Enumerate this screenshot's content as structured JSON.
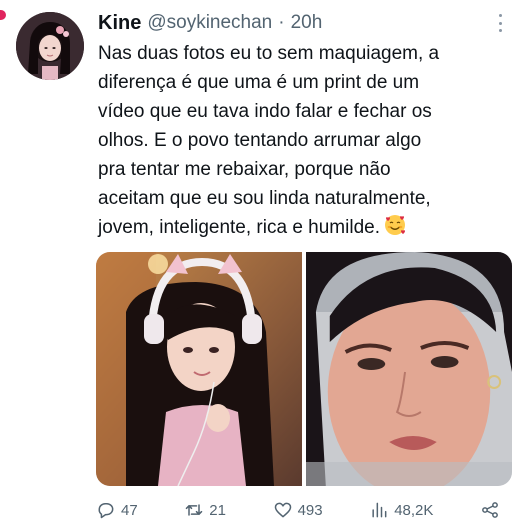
{
  "tweet": {
    "author_name": "Kine",
    "handle": "@soykinechan",
    "separator": "·",
    "time": "20h",
    "text_lines": [
      "Nas duas fotos eu to sem maquiagem, a",
      "diferença é que uma é um print de um",
      "vídeo que eu tava indo falar e fechar os",
      "olhos. E o povo tentando arrumar algo",
      "pra tentar me rebaixar, porque não",
      "aceitam que eu sou linda naturalmente,",
      "jovem, inteligente, rica e humilde."
    ],
    "emoji": "smiling-face-with-hearts-icon"
  },
  "actions": {
    "replies": "47",
    "retweets": "21",
    "likes": "493",
    "views": "48,2K"
  },
  "colors": {
    "text": "#0f1419",
    "secondary": "#536471",
    "accent_dot": "#e0245e"
  }
}
